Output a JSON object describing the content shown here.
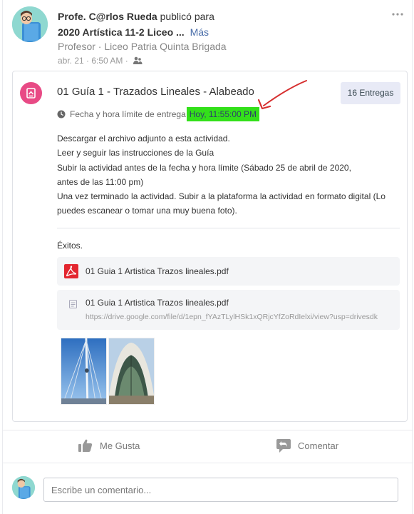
{
  "post": {
    "author": "Profe. C@rlos Rueda",
    "action_text": "publicó para",
    "group": "2020 Artística 11-2 Liceo ...",
    "more_label": "Más",
    "role_line": "Profesor · Liceo Patria Quinta Brigada",
    "timestamp": "abr. 21 · 6:50 AM ·",
    "menu_icon": "more-horizontal-icon"
  },
  "assignment": {
    "icon": "assignment-icon",
    "title": "01 Guía 1 - Trazados Lineales - Alabeado",
    "submissions_label": "16 Entregas",
    "deadline_label": "Fecha y hora límite de entrega",
    "deadline_value": "Hoy, 11:55:00 PM",
    "highlight_color": "#33e01a",
    "description": [
      "Descargar el archivo adjunto a esta actividad.",
      "Leer y seguir las instrucciones de la Guía",
      "Subir la actividad antes de la fecha y hora límite (Sábado 25 de abril de 2020,",
      "antes de las 11:00 pm)",
      "Una vez terminado la actividad. Subir a la plataforma la actividad en formato digital (Lo",
      "puedes escanear o tomar una muy buena foto)."
    ],
    "closing": "Éxitos.",
    "attachment": {
      "name": "01 Guia 1 Artistica Trazos lineales.pdf",
      "icon": "pdf-icon"
    },
    "link": {
      "name": "01 Guia 1 Artistica Trazos lineales.pdf",
      "url": "https://drive.google.com/file/d/1epn_fYAzTLylHSk1xQRjcYfZoRdIelxi/view?usp=drivesdk",
      "icon": "document-icon"
    }
  },
  "actions": {
    "like_label": "Me Gusta",
    "comment_label": "Comentar"
  },
  "comment_box": {
    "placeholder": "Escribe un comentario..."
  }
}
